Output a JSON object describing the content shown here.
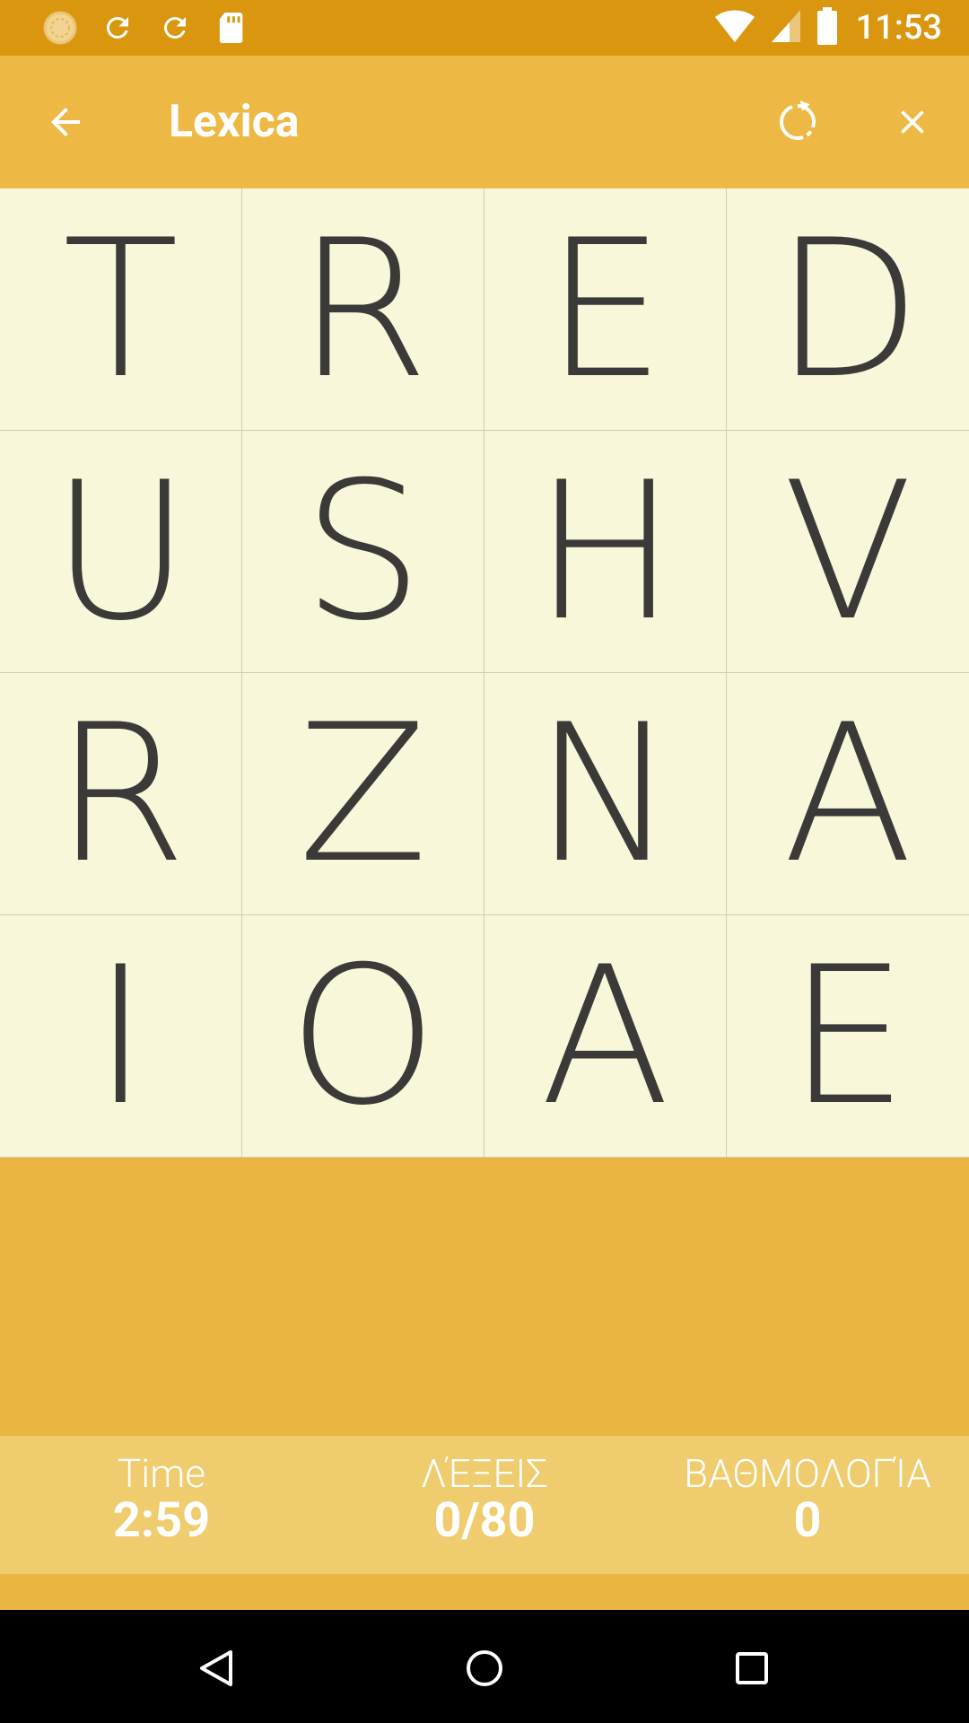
{
  "status_bar": {
    "time": "11:53",
    "left_icons": [
      "loading-icon",
      "sync-icon",
      "sync-icon",
      "sd-card-icon"
    ],
    "right_icons": [
      "wifi-icon",
      "signal-icon",
      "battery-icon"
    ]
  },
  "app_bar": {
    "title": "Lexica",
    "back_icon": "arrow-back-icon",
    "refresh_icon": "refresh-icon",
    "close_icon": "close-icon"
  },
  "board": {
    "letters": [
      "T",
      "R",
      "E",
      "D",
      "U",
      "S",
      "H",
      "V",
      "R",
      "Z",
      "N",
      "A",
      "I",
      "O",
      "A",
      "E"
    ]
  },
  "stats": {
    "time_label": "Time",
    "time_value": "2:59",
    "words_label": "ΛΈΞΕΙΣ",
    "words_value": "0/80",
    "score_label": "ΒΑΘΜΟΛΟΓΊΑ",
    "score_value": "0"
  },
  "colors": {
    "status_bar": "#D9960E",
    "app_bar": "#EDB843",
    "background": "#EBB541",
    "tile": "#F9F7DA",
    "tile_text": "#3B3A38",
    "score_bar": "#EFCC6D"
  },
  "nav_bar": {
    "icons": [
      "nav-back-icon",
      "nav-home-icon",
      "nav-recents-icon"
    ]
  }
}
